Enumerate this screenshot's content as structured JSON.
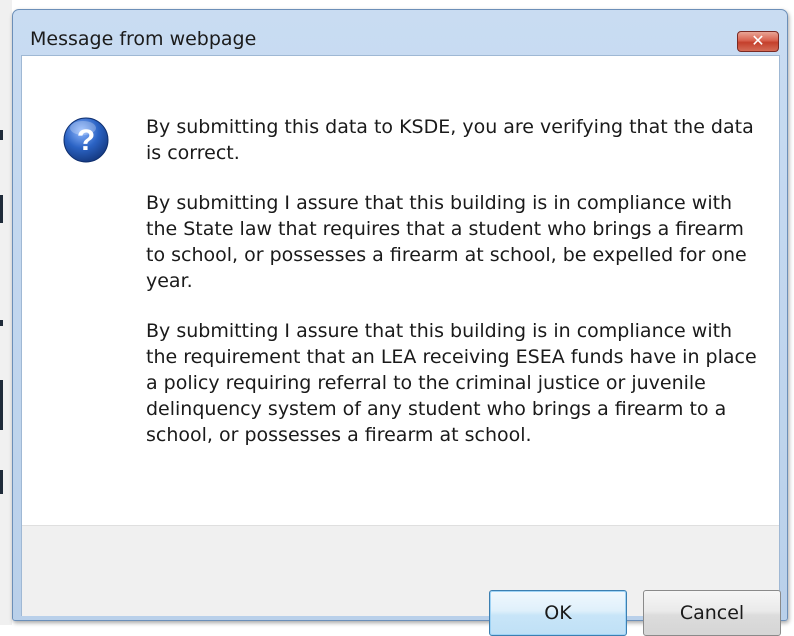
{
  "dialog": {
    "title": "Message from webpage",
    "close_label": "✕",
    "icon": "question-icon",
    "message_paragraphs": [
      "By submitting this data to KSDE, you are verifying that the data is correct.",
      "By submitting I assure that this building is in compliance with the State law that requires that a student who brings a firearm to school, or possesses a firearm at school, be expelled for one year.",
      "By submitting I assure that this building is in compliance with the requirement that an LEA receiving ESEA funds have in place a policy requiring referral to the criminal justice or juvenile delinquency system of any student who brings a firearm to a school, or possesses a firearm at school."
    ],
    "buttons": {
      "ok": "OK",
      "cancel": "Cancel"
    }
  },
  "colors": {
    "title_bar": "#c9dcf2",
    "close_button": "#c4402c",
    "icon_blue": "#2b63c4",
    "default_button_border": "#3c7fb1"
  }
}
